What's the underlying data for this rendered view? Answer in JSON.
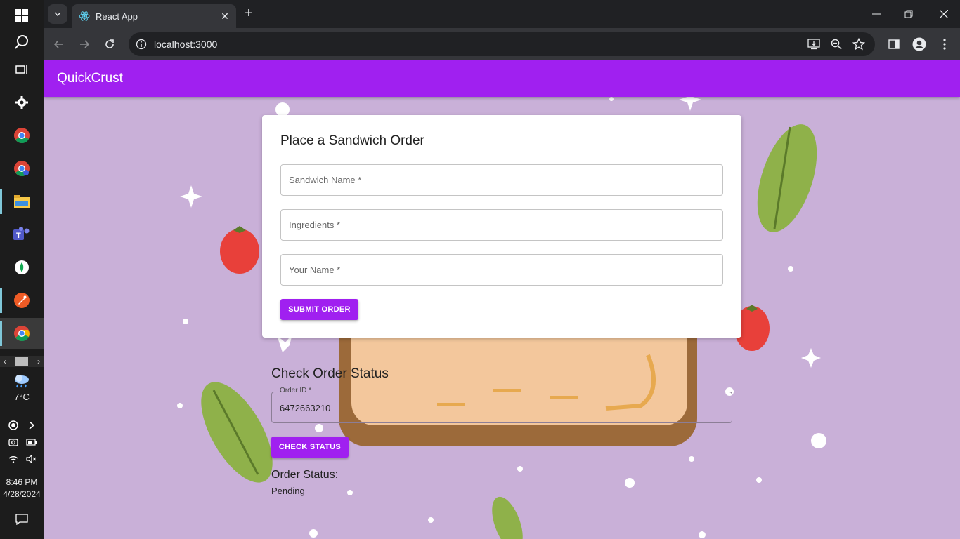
{
  "taskbar": {
    "weather_temp": "7°C",
    "clock_time": "8:46 PM",
    "clock_date": "4/28/2024"
  },
  "browser": {
    "tab_title": "React App",
    "tab_close": "✕",
    "new_tab": "+",
    "url": "localhost:3000"
  },
  "app": {
    "brand": "QuickCrust",
    "order_form": {
      "title": "Place a Sandwich Order",
      "sandwich_name_label": "Sandwich Name *",
      "ingredients_label": "Ingredients *",
      "your_name_label": "Your Name *",
      "submit_label": "SUBMIT ORDER"
    },
    "status_check": {
      "title": "Check Order Status",
      "order_id_label": "Order ID *",
      "order_id_value": "6472663210",
      "check_label": "CHECK STATUS",
      "status_label": "Order Status:",
      "status_value": "Pending"
    }
  },
  "colors": {
    "brand_purple": "#a020f0",
    "page_bg": "#c9b0d8"
  }
}
